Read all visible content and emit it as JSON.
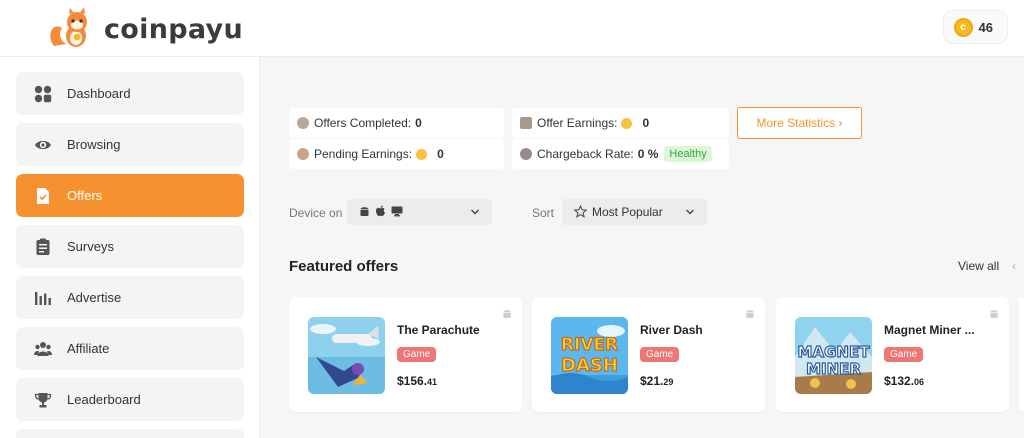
{
  "brand": {
    "name": "coinpayu"
  },
  "header": {
    "coins": "46"
  },
  "sidebar": {
    "items": [
      {
        "label": "Dashboard",
        "icon": "dashboard-icon"
      },
      {
        "label": "Browsing",
        "icon": "eye-icon"
      },
      {
        "label": "Offers",
        "icon": "offers-icon",
        "active": true
      },
      {
        "label": "Surveys",
        "icon": "survey-icon"
      },
      {
        "label": "Advertise",
        "icon": "bar-chart-icon"
      },
      {
        "label": "Affiliate",
        "icon": "group-icon"
      },
      {
        "label": "Leaderboard",
        "icon": "trophy-icon"
      }
    ]
  },
  "stats": {
    "offers_completed_label": "Offers Completed:",
    "offers_completed_value": "0",
    "offer_earnings_label": "Offer Earnings:",
    "offer_earnings_value": "0",
    "pending_earnings_label": "Pending Earnings:",
    "pending_earnings_value": "0",
    "chargeback_rate_label": "Chargeback Rate:",
    "chargeback_rate_value": "0 %",
    "health_badge": "Healthy",
    "more_statistics": "More Statistics ›"
  },
  "filters": {
    "device_label": "Device on",
    "sort_label": "Sort",
    "sort_value": "Most Popular"
  },
  "featured": {
    "title": "Featured offers",
    "view_all": "View all",
    "offers": [
      {
        "title": "The Parachute",
        "tag": "Game",
        "price_main": "$156.",
        "price_cents": "41"
      },
      {
        "title": "River Dash",
        "tag": "Game",
        "price_main": "$21.",
        "price_cents": "29"
      },
      {
        "title": "Magnet Miner ...",
        "tag": "Game",
        "price_main": "$132.",
        "price_cents": "06"
      }
    ]
  },
  "colors": {
    "accent": "#f5922f",
    "tag": "#f07575",
    "healthy_bg": "#dbf7d6"
  }
}
